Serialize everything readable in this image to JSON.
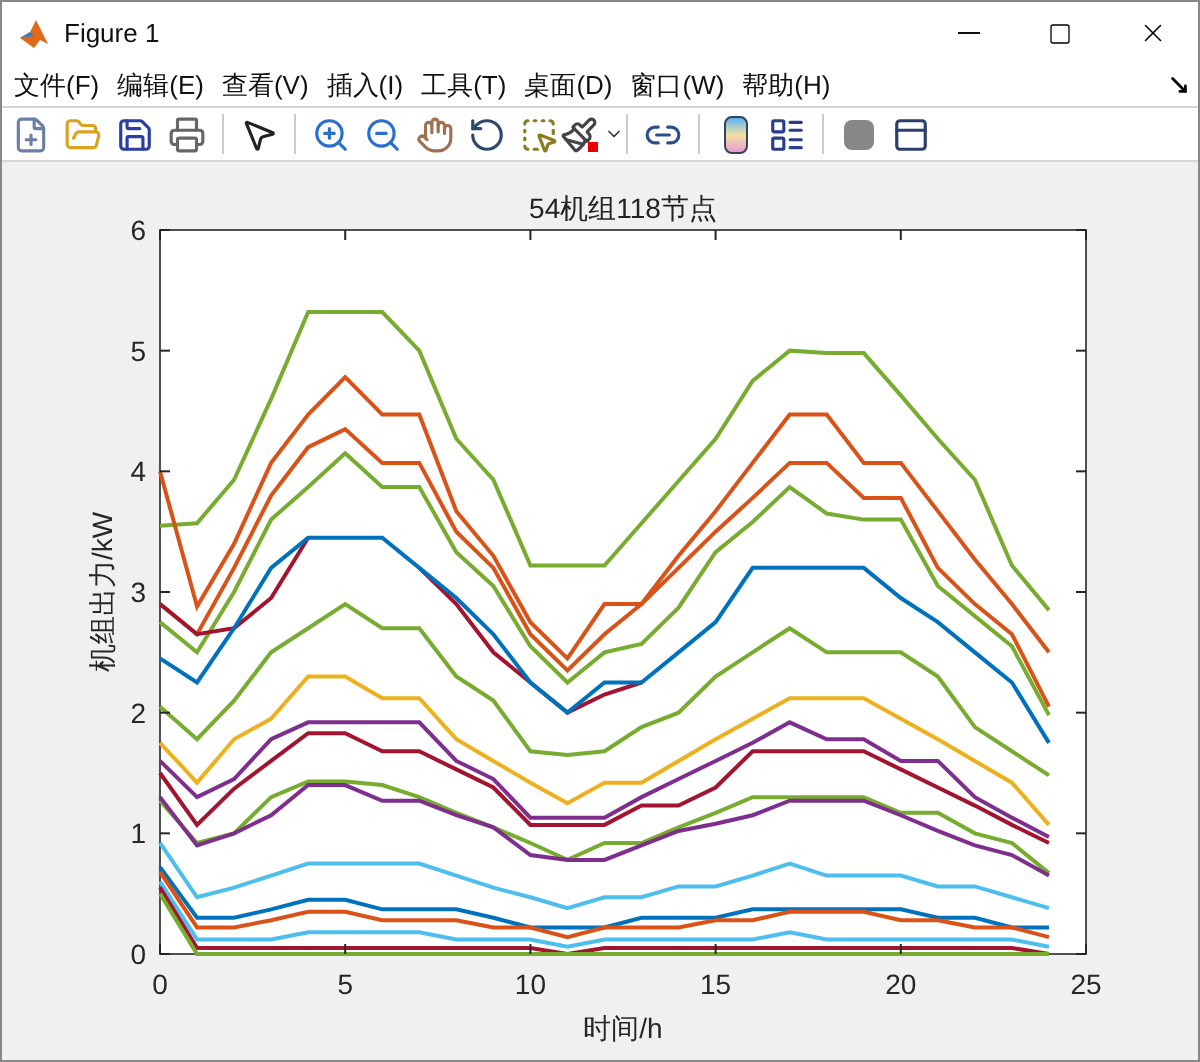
{
  "window": {
    "title": "Figure 1"
  },
  "menu": [
    "文件(F)",
    "编辑(E)",
    "查看(V)",
    "插入(I)",
    "工具(T)",
    "桌面(D)",
    "窗口(W)",
    "帮助(H)"
  ],
  "toolbar": [
    {
      "kind": "new"
    },
    {
      "kind": "open"
    },
    {
      "kind": "save"
    },
    {
      "kind": "print"
    },
    {
      "kind": "sep"
    },
    {
      "kind": "pointer"
    },
    {
      "kind": "sep"
    },
    {
      "kind": "zoomin"
    },
    {
      "kind": "zoomout"
    },
    {
      "kind": "pan"
    },
    {
      "kind": "rotate"
    },
    {
      "kind": "cursor"
    },
    {
      "kind": "brush"
    },
    {
      "kind": "sep"
    },
    {
      "kind": "link"
    },
    {
      "kind": "sep"
    },
    {
      "kind": "colorbar"
    },
    {
      "kind": "legend"
    },
    {
      "kind": "sep"
    },
    {
      "kind": "hide"
    },
    {
      "kind": "dock"
    }
  ],
  "chart_data": {
    "type": "line",
    "title": "54机组118节点",
    "xlabel": "时间/h",
    "ylabel": "机组出力/kW",
    "x": [
      0,
      1,
      2,
      3,
      4,
      5,
      6,
      7,
      8,
      9,
      10,
      11,
      12,
      13,
      14,
      15,
      16,
      17,
      18,
      19,
      20,
      21,
      22,
      23,
      24
    ],
    "xlim": [
      0,
      25
    ],
    "ylim": [
      0,
      6
    ],
    "xticks": [
      0,
      5,
      10,
      15,
      20,
      25
    ],
    "yticks": [
      0,
      1,
      2,
      3,
      4,
      5,
      6
    ],
    "series": [
      {
        "color": "#77ac30",
        "values": [
          3.55,
          3.57,
          3.93,
          4.6,
          5.32,
          5.32,
          5.32,
          5.0,
          4.27,
          3.93,
          3.22,
          3.22,
          3.22,
          3.57,
          3.92,
          4.27,
          4.75,
          5.0,
          4.98,
          4.98,
          4.63,
          4.27,
          3.93,
          3.22,
          2.85
        ]
      },
      {
        "color": "#d95319",
        "values": [
          4.0,
          2.88,
          3.4,
          4.07,
          4.47,
          4.78,
          4.47,
          4.47,
          3.67,
          3.3,
          2.75,
          2.45,
          2.9,
          2.9,
          3.3,
          3.67,
          4.07,
          4.47,
          4.47,
          4.07,
          4.07,
          3.67,
          3.27,
          2.9,
          2.5
        ]
      },
      {
        "color": "#d95319",
        "values": [
          2.9,
          2.65,
          3.2,
          3.8,
          4.2,
          4.35,
          4.07,
          4.07,
          3.5,
          3.2,
          2.65,
          2.35,
          2.65,
          2.9,
          3.2,
          3.5,
          3.78,
          4.07,
          4.07,
          3.78,
          3.78,
          3.2,
          2.9,
          2.65,
          2.05
        ]
      },
      {
        "color": "#77ac30",
        "values": [
          2.75,
          2.5,
          3.0,
          3.6,
          3.87,
          4.15,
          3.87,
          3.87,
          3.33,
          3.05,
          2.55,
          2.25,
          2.5,
          2.57,
          2.87,
          3.33,
          3.58,
          3.87,
          3.65,
          3.6,
          3.6,
          3.05,
          2.8,
          2.55,
          1.98
        ]
      },
      {
        "color": "#a2142f",
        "values": [
          2.9,
          2.65,
          2.7,
          2.95,
          3.45,
          null,
          null,
          3.2,
          2.9,
          2.5,
          2.25,
          2.0,
          2.15,
          2.25,
          null,
          null,
          null,
          null,
          null,
          null,
          null,
          null,
          null,
          null,
          null
        ]
      },
      {
        "color": "#0072bd",
        "values": [
          2.45,
          2.25,
          2.7,
          3.2,
          3.45,
          3.45,
          3.45,
          3.2,
          2.95,
          2.65,
          2.25,
          2.0,
          2.25,
          2.25,
          2.5,
          2.75,
          3.2,
          3.2,
          3.2,
          3.2,
          2.95,
          2.75,
          2.5,
          2.25,
          1.75
        ]
      },
      {
        "color": "#77ac30",
        "values": [
          2.05,
          1.78,
          2.1,
          2.5,
          2.7,
          2.9,
          2.7,
          2.7,
          2.3,
          2.1,
          1.68,
          1.65,
          1.68,
          1.88,
          2.0,
          2.3,
          2.5,
          2.7,
          2.5,
          2.5,
          2.5,
          2.3,
          1.88,
          1.68,
          1.48
        ]
      },
      {
        "color": "#edb120",
        "values": [
          1.75,
          1.42,
          1.78,
          1.95,
          2.3,
          2.3,
          2.12,
          2.12,
          1.78,
          1.6,
          1.42,
          1.25,
          1.42,
          1.42,
          1.6,
          1.78,
          1.95,
          2.12,
          2.12,
          2.12,
          1.95,
          1.78,
          1.6,
          1.42,
          1.07
        ]
      },
      {
        "color": "#7e2f8e",
        "values": [
          1.6,
          1.3,
          1.45,
          1.78,
          1.92,
          1.92,
          1.92,
          1.92,
          1.6,
          1.45,
          1.13,
          1.13,
          1.13,
          1.3,
          1.45,
          1.6,
          1.75,
          1.92,
          1.78,
          1.78,
          1.6,
          1.6,
          1.3,
          1.13,
          0.97
        ]
      },
      {
        "color": "#a2142f",
        "values": [
          1.5,
          1.07,
          1.37,
          1.6,
          1.83,
          1.83,
          1.68,
          1.68,
          1.53,
          1.38,
          1.07,
          1.07,
          1.07,
          1.23,
          1.23,
          1.38,
          1.68,
          1.68,
          1.68,
          1.68,
          1.53,
          1.38,
          1.23,
          1.07,
          0.92
        ]
      },
      {
        "color": "#77ac30",
        "values": [
          1.27,
          0.92,
          1.0,
          1.3,
          1.43,
          1.43,
          1.4,
          1.3,
          1.17,
          1.05,
          0.92,
          0.78,
          0.92,
          0.92,
          1.05,
          1.17,
          1.3,
          1.3,
          1.3,
          1.3,
          1.17,
          1.17,
          1.0,
          0.92,
          0.67
        ]
      },
      {
        "color": "#7e2f8e",
        "values": [
          1.3,
          0.9,
          1.0,
          1.15,
          1.4,
          1.4,
          1.27,
          1.27,
          1.15,
          1.05,
          0.82,
          0.78,
          0.78,
          0.9,
          1.02,
          1.08,
          1.15,
          1.27,
          1.27,
          1.27,
          1.15,
          1.02,
          0.9,
          0.82,
          0.65
        ]
      },
      {
        "color": "#4dbeee",
        "values": [
          0.92,
          0.47,
          0.55,
          0.65,
          0.75,
          0.75,
          0.75,
          0.75,
          0.65,
          0.55,
          0.47,
          0.38,
          0.47,
          0.47,
          0.56,
          0.56,
          0.65,
          0.75,
          0.65,
          0.65,
          0.65,
          0.56,
          0.56,
          0.47,
          0.38
        ]
      },
      {
        "color": "#0072bd",
        "values": [
          0.72,
          0.3,
          0.3,
          0.37,
          0.45,
          0.45,
          0.37,
          0.37,
          0.37,
          0.3,
          0.22,
          0.22,
          0.22,
          0.3,
          0.3,
          0.3,
          0.37,
          0.37,
          0.37,
          0.37,
          0.37,
          0.3,
          0.3,
          0.22,
          0.22
        ]
      },
      {
        "color": "#d95319",
        "values": [
          0.68,
          0.22,
          0.22,
          0.28,
          0.35,
          0.35,
          0.28,
          0.28,
          0.28,
          0.22,
          0.22,
          0.14,
          0.22,
          0.22,
          0.22,
          0.28,
          0.28,
          0.35,
          0.35,
          0.35,
          0.28,
          0.28,
          0.22,
          0.22,
          0.14
        ]
      },
      {
        "color": "#4dbeee",
        "values": [
          0.6,
          0.12,
          0.12,
          0.12,
          0.18,
          0.18,
          0.18,
          0.18,
          0.12,
          0.12,
          0.12,
          0.06,
          0.12,
          0.12,
          0.12,
          0.12,
          0.12,
          0.18,
          0.12,
          0.12,
          0.12,
          0.12,
          0.12,
          0.12,
          0.06
        ]
      },
      {
        "color": "#a2142f",
        "values": [
          0.55,
          0.05,
          0.05,
          0.05,
          0.05,
          0.05,
          0.05,
          0.05,
          0.05,
          0.05,
          0.05,
          0.0,
          0.05,
          0.05,
          0.05,
          0.05,
          0.05,
          0.05,
          0.05,
          0.05,
          0.05,
          0.05,
          0.05,
          0.05,
          0.0
        ]
      },
      {
        "color": "#77ac30",
        "values": [
          0.5,
          0.0,
          0.0,
          0.0,
          0.0,
          0.0,
          0.0,
          0.0,
          0.0,
          0.0,
          0.0,
          0.0,
          0.0,
          0.0,
          0.0,
          0.0,
          0.0,
          0.0,
          0.0,
          0.0,
          0.0,
          0.0,
          0.0,
          0.0,
          0.0
        ]
      }
    ]
  }
}
